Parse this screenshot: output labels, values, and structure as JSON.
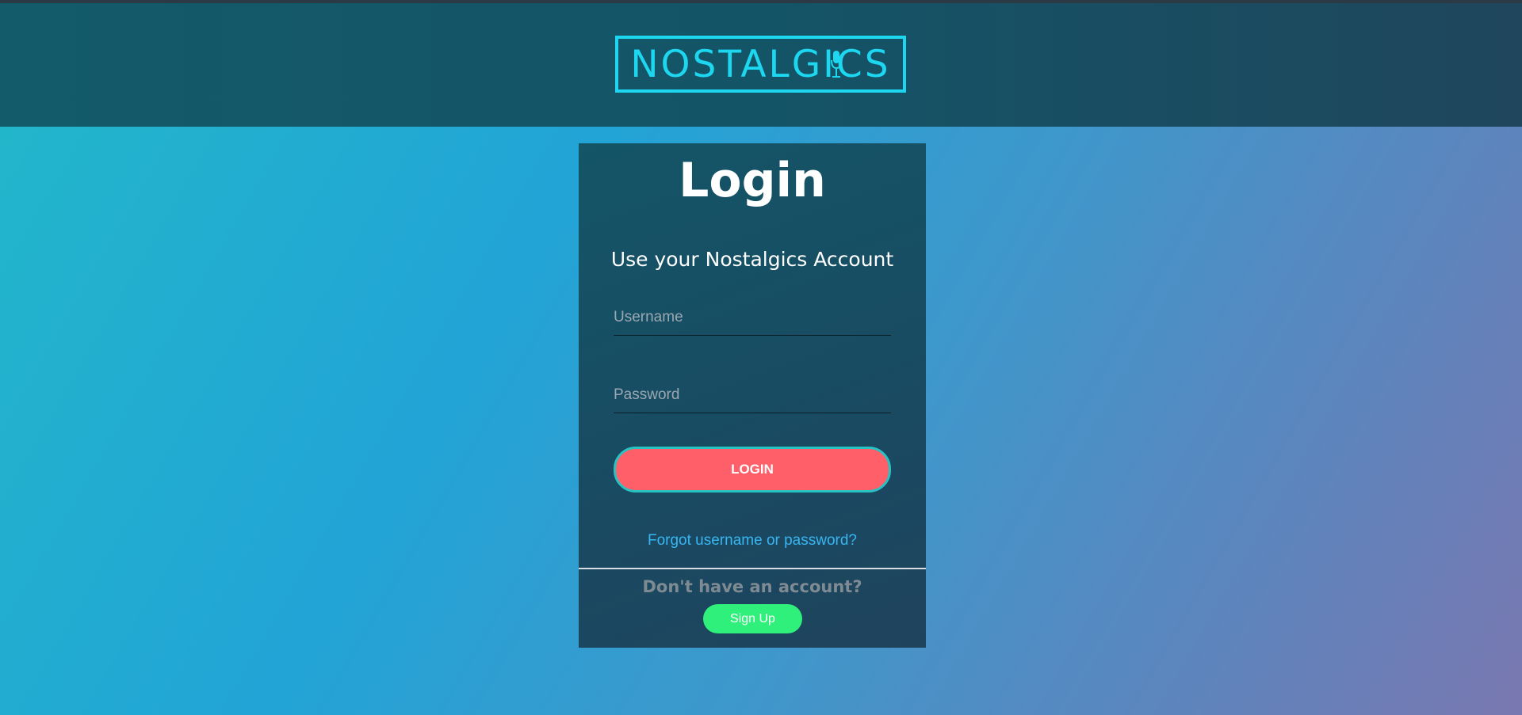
{
  "header": {
    "logo_text": "NOSTALGICS",
    "accent_color": "#1cd7ef"
  },
  "login_card": {
    "title": "Login",
    "subtitle": "Use your Nostalgics Account",
    "username": {
      "placeholder": "Username",
      "value": ""
    },
    "password": {
      "placeholder": "Password",
      "value": ""
    },
    "login_button_label": "LOGIN",
    "forgot_link_text": "Forgot username or password?",
    "no_account_text": "Don't have an account?",
    "signup_button_label": "Sign Up"
  },
  "colors": {
    "login_button": "#ff5f69",
    "signup_button": "#2ef07a",
    "link": "#37b6f2"
  },
  "icons": {
    "logo_microphone": "microphone-icon"
  }
}
